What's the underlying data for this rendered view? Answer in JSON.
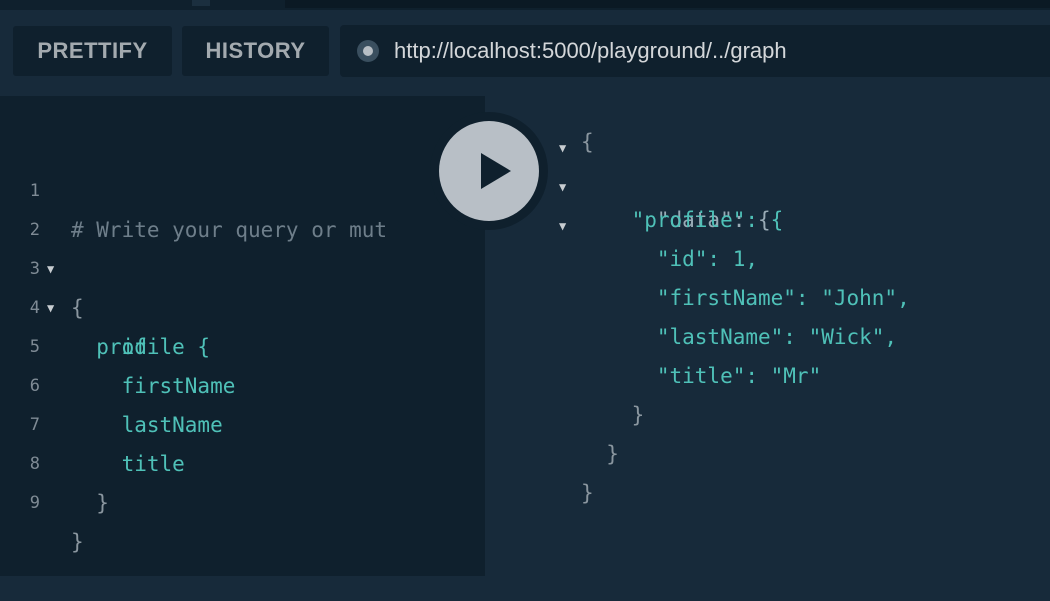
{
  "toolbar": {
    "prettify_label": "PRETTIFY",
    "history_label": "HISTORY",
    "endpoint_url": "http://localhost:5000/playground/../graph"
  },
  "editor": {
    "lines": [
      {
        "num": "1",
        "text": "# Write your query or mut"
      },
      {
        "num": "2",
        "text": "{"
      },
      {
        "num": "3",
        "text": "  profile {"
      },
      {
        "num": "4",
        "text": "    id"
      },
      {
        "num": "5",
        "text": "    firstName"
      },
      {
        "num": "6",
        "text": "    lastName"
      },
      {
        "num": "7",
        "text": "    title"
      },
      {
        "num": "8",
        "text": "  }"
      },
      {
        "num": "9",
        "text": "}"
      }
    ]
  },
  "result": {
    "lines": [
      "{",
      "  \"data\": {",
      "    \"profile\": {",
      "      \"id\": 1,",
      "      \"firstName\": \"John\",",
      "      \"lastName\": \"Wick\",",
      "      \"title\": \"Mr\"",
      "    }",
      "  }",
      "}"
    ]
  },
  "icons": {
    "play": "play-icon",
    "status": "status-dot-icon",
    "fold": "fold-arrow-icon"
  },
  "colors": {
    "editor_bg": "#0f202d",
    "result_bg": "#172a3a",
    "field": "#4fc1b8",
    "comment": "#6e7e8a"
  }
}
